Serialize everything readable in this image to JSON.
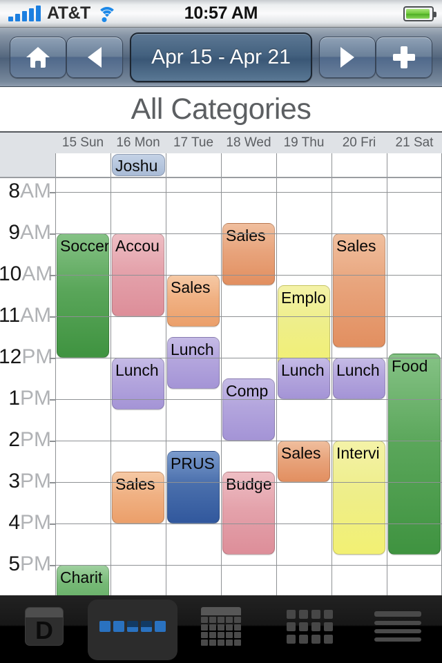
{
  "status_bar": {
    "carrier": "AT&T",
    "time": "10:57 AM",
    "signal_icon": "signal-bars-icon",
    "wifi_icon": "wifi-icon",
    "battery_icon": "battery-icon"
  },
  "toolbar": {
    "home_label": "home-icon",
    "prev_label": "prev-arrow-icon",
    "date_range": "Apr 15 - Apr 21",
    "next_label": "next-arrow-icon",
    "add_label": "plus-icon"
  },
  "header": {
    "title": "All Categories"
  },
  "days": [
    {
      "label": "15 Sun"
    },
    {
      "label": "16 Mon"
    },
    {
      "label": "17 Tue"
    },
    {
      "label": "18 Wed"
    },
    {
      "label": "19 Thu"
    },
    {
      "label": "20 Fri"
    },
    {
      "label": "21 Sat"
    }
  ],
  "all_day_events": [
    {
      "day": 1,
      "title": "Joshu",
      "color": "#b3c4dc"
    }
  ],
  "hours": [
    {
      "num": "8",
      "mer": "AM"
    },
    {
      "num": "9",
      "mer": "AM"
    },
    {
      "num": "10",
      "mer": "AM"
    },
    {
      "num": "11",
      "mer": "AM"
    },
    {
      "num": "12",
      "mer": "PM"
    },
    {
      "num": "1",
      "mer": "PM"
    },
    {
      "num": "2",
      "mer": "PM"
    },
    {
      "num": "3",
      "mer": "PM"
    },
    {
      "num": "4",
      "mer": "PM"
    },
    {
      "num": "5",
      "mer": "PM"
    }
  ],
  "events": [
    {
      "day": 0,
      "title": "Soccer",
      "start": 9.0,
      "end": 12.0,
      "color": "#5aa65a",
      "top": "#85c285",
      "bottom": "#3f9340"
    },
    {
      "day": 0,
      "title": "Charit",
      "start": 17.0,
      "end": 18.0,
      "color": "#76b976",
      "top": "#9fd09f",
      "bottom": "#64ad64"
    },
    {
      "day": 1,
      "title": "Accou",
      "start": 9.0,
      "end": 11.0,
      "color": "#e4a2ab",
      "top": "#eebec4",
      "bottom": "#dd8e99"
    },
    {
      "day": 1,
      "title": "Lunch",
      "start": 12.0,
      "end": 13.25,
      "color": "#b3a5dd",
      "top": "#c5bbe6",
      "bottom": "#a494d6"
    },
    {
      "day": 1,
      "title": "Sales",
      "start": 14.75,
      "end": 16.0,
      "color": "#f0b183",
      "top": "#f6c9a5",
      "bottom": "#eb9f6a"
    },
    {
      "day": 2,
      "title": "Sales",
      "start": 10.0,
      "end": 11.25,
      "color": "#f0b183",
      "top": "#f6c9a5",
      "bottom": "#eb9f6a"
    },
    {
      "day": 2,
      "title": "Lunch",
      "start": 11.5,
      "end": 12.75,
      "color": "#b3a5dd",
      "top": "#c5bbe6",
      "bottom": "#a494d6"
    },
    {
      "day": 2,
      "title": "PRUS",
      "start": 14.25,
      "end": 16.0,
      "color": "#4a6fac",
      "top": "#7b9bcd",
      "bottom": "#31589d"
    },
    {
      "day": 3,
      "title": "Sales",
      "start": 8.75,
      "end": 10.25,
      "color": "#e8a47c",
      "top": "#f0bf9e",
      "bottom": "#e28f60"
    },
    {
      "day": 3,
      "title": "Comp",
      "start": 12.5,
      "end": 14.0,
      "color": "#b3a5dd",
      "top": "#c5bbe6",
      "bottom": "#a494d6"
    },
    {
      "day": 3,
      "title": "Budge",
      "start": 14.75,
      "end": 16.75,
      "color": "#e4a2ab",
      "top": "#eebec4",
      "bottom": "#dd8e99"
    },
    {
      "day": 4,
      "title": "Emplo",
      "start": 10.25,
      "end": 12.25,
      "color": "#eeee8a",
      "top": "#f4f2a8",
      "bottom": "#f2f073"
    },
    {
      "day": 4,
      "title": "Lunch",
      "start": 12.0,
      "end": 13.0,
      "color": "#b3a5dd",
      "top": "#c5bbe6",
      "bottom": "#a494d6"
    },
    {
      "day": 4,
      "title": "Sales",
      "start": 14.0,
      "end": 15.0,
      "color": "#e8a47c",
      "top": "#f0bf9e",
      "bottom": "#e28f60"
    },
    {
      "day": 5,
      "title": "Sales",
      "start": 9.0,
      "end": 11.75,
      "color": "#e8a47c",
      "top": "#f0bf9e",
      "bottom": "#e28f60"
    },
    {
      "day": 5,
      "title": "Lunch",
      "start": 12.0,
      "end": 13.0,
      "color": "#b3a5dd",
      "top": "#c5bbe6",
      "bottom": "#a494d6"
    },
    {
      "day": 5,
      "title": "Intervi",
      "start": 14.0,
      "end": 16.75,
      "color": "#eeee8a",
      "top": "#f4f2a8",
      "bottom": "#f2f073"
    },
    {
      "day": 6,
      "title": "Food",
      "start": 11.9,
      "end": 16.75,
      "color": "#5aa65a",
      "top": "#85c285",
      "bottom": "#3f9340"
    }
  ],
  "tabs": [
    {
      "name": "day",
      "icon": "day-view-icon",
      "letter": "D",
      "selected": false
    },
    {
      "name": "week",
      "icon": "week-view-icon",
      "selected": true
    },
    {
      "name": "month",
      "icon": "month-view-icon",
      "selected": false
    },
    {
      "name": "grid",
      "icon": "grid-view-icon",
      "selected": false
    },
    {
      "name": "list",
      "icon": "list-view-icon",
      "selected": false
    }
  ]
}
